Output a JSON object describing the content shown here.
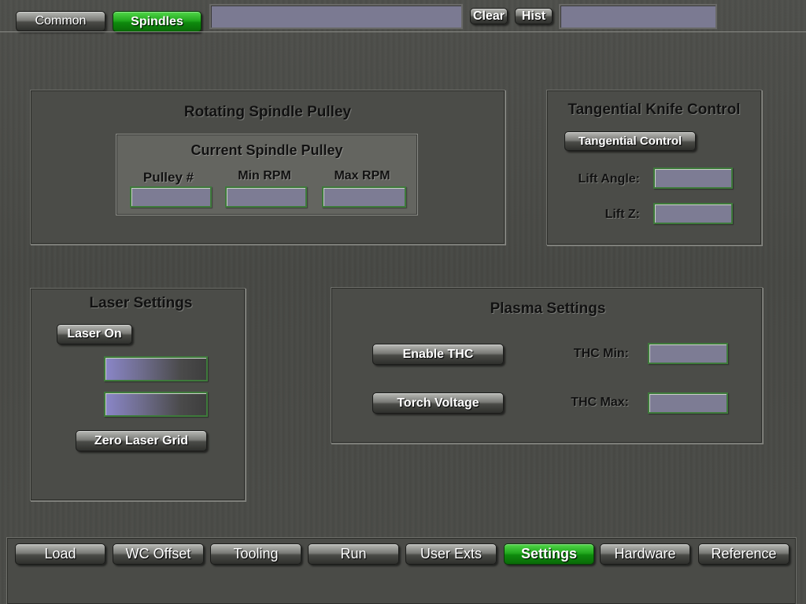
{
  "top_bar": {
    "common_label": "Common",
    "spindles_label": "Spindles",
    "message_value": "",
    "clear_label": "Clear",
    "hist_label": "Hist",
    "status_value": ""
  },
  "rotating_spindle": {
    "title": "Rotating Spindle Pulley",
    "current_title": "Current Spindle Pulley",
    "pulley_label": "Pulley #",
    "min_rpm_label": "Min RPM",
    "max_rpm_label": "Max RPM",
    "pulley_value": "",
    "min_rpm_value": "",
    "max_rpm_value": ""
  },
  "tangential": {
    "title": "Tangential Knife Control",
    "control_label": "Tangential Control",
    "lift_angle_label": "Lift Angle:",
    "lift_z_label": "Lift Z:",
    "lift_angle_value": "",
    "lift_z_value": ""
  },
  "laser": {
    "title": "Laser Settings",
    "on_label": "Laser On",
    "zero_label": "Zero Laser Grid",
    "field1_value": "",
    "field2_value": ""
  },
  "plasma": {
    "title": "Plasma Settings",
    "enable_thc_label": "Enable THC",
    "torch_voltage_label": "Torch Voltage",
    "thc_min_label": "THC Min:",
    "thc_max_label": "THC Max:",
    "thc_min_value": "",
    "thc_max_value": ""
  },
  "bottom_nav": {
    "items": [
      {
        "label": "Load",
        "active": false
      },
      {
        "label": "WC Offset",
        "active": false
      },
      {
        "label": "Tooling",
        "active": false
      },
      {
        "label": "Run",
        "active": false
      },
      {
        "label": "User Exts",
        "active": false
      },
      {
        "label": "Settings",
        "active": true
      },
      {
        "label": "Hardware",
        "active": false
      },
      {
        "label": "Reference",
        "active": false
      }
    ]
  },
  "colors": {
    "active_green": "#1fa51b",
    "field_fill": "#7d7c94",
    "field_border": "#3e7a3b",
    "background": "#4b4c48"
  }
}
